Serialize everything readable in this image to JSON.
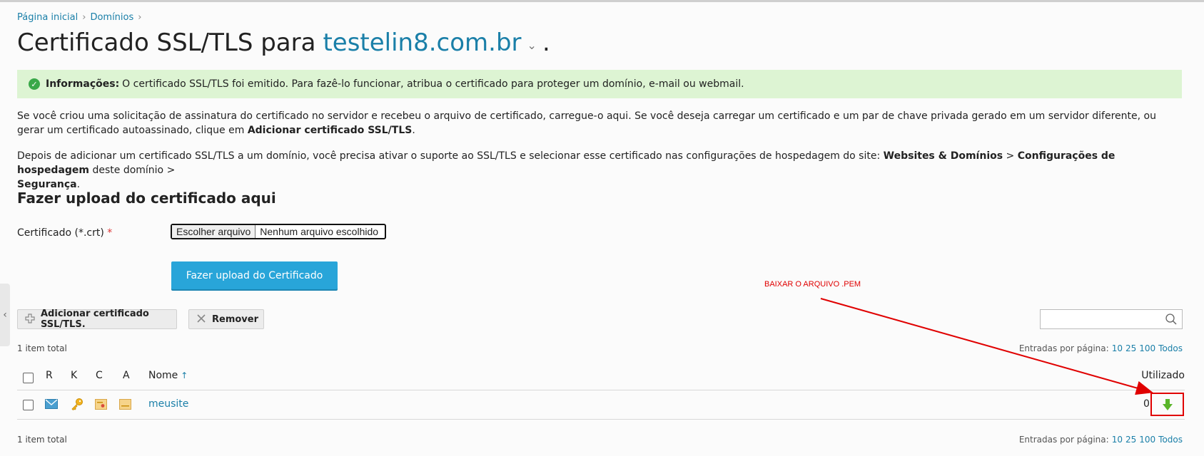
{
  "breadcrumb": {
    "home": "Página inicial",
    "domains": "Domínios"
  },
  "title": {
    "prefix": "Certificado SSL/TLS para",
    "domain": "testelin8.com.br",
    "suffix": "."
  },
  "info": {
    "label": "Informações:",
    "text": "O certificado SSL/TLS foi emitido. Para fazê-lo funcionar, atribua o certificado para proteger um domínio, e-mail ou webmail."
  },
  "para1": {
    "text": "Se você criou uma solicitação de assinatura do certificado no servidor e recebeu o arquivo de certificado, carregue-o aqui. Se você deseja carregar um certificado e um par de chave privada gerado em um servidor diferente, ou gerar um certificado autoassinado, clique em",
    "bold": "Adicionar certificado SSL/TLS",
    "end": "."
  },
  "para2": {
    "text": "Depois de adicionar um certificado SSL/TLS a um domínio, você precisa ativar o suporte ao SSL/TLS e selecionar esse certificado nas configurações de hospedagem do site:",
    "b1": "Websites & Domínios",
    "gt1": ">",
    "b2": "Configurações de hospedagem",
    "mid": "deste domínio >",
    "b3": "Segurança",
    "end": "."
  },
  "upload": {
    "section_title": "Fazer upload do certificado aqui",
    "cert_label": "Certificado (*.crt)",
    "required_mark": "*",
    "choose_file": "Escolher arquivo",
    "no_file": "Nenhum arquivo escolhido",
    "upload_button": "Fazer upload do Certificado"
  },
  "toolbar": {
    "add_button": "Adicionar certificado SSL/TLS.",
    "remove_button": "Remover",
    "search_placeholder": ""
  },
  "list": {
    "total_top": "1 item total",
    "total_bottom": "1 item total",
    "perpage_label": "Entradas por página:",
    "perpage_options": [
      "10",
      "25",
      "100",
      "Todos"
    ],
    "columns": {
      "r": "R",
      "k": "K",
      "c": "C",
      "a": "A",
      "name": "Nome",
      "used": "Utilizado"
    },
    "rows": [
      {
        "name": "meusite",
        "used": "0"
      }
    ]
  },
  "annotation": {
    "text": "BAIXAR O ARQUIVO .PEM",
    "color": "#e00000"
  },
  "colors": {
    "link": "#1a7fa8",
    "info_bg": "#ddf4d3",
    "primary_button": "#28a5d9",
    "download_icon": "#5ab52a"
  }
}
